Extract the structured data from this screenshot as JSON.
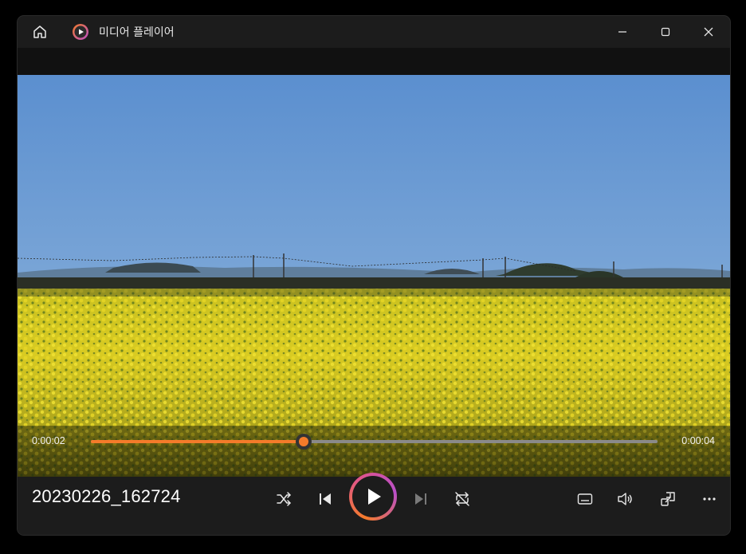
{
  "window": {
    "title": "미디어 플레이어",
    "controls": [
      "minimize-icon",
      "maximize-icon",
      "close-icon"
    ]
  },
  "titlebar_icons": {
    "home": "home-icon",
    "app": "media-player-app-icon"
  },
  "playback": {
    "current_time": "0:00:02",
    "duration": "0:00:04",
    "progress_fraction": 0.375
  },
  "media": {
    "filename": "20230226_162724"
  },
  "transport": {
    "shuffle": "shuffle-icon",
    "previous": "previous-icon",
    "play": "play-icon",
    "next": "next-icon",
    "repeat": "repeat-icon"
  },
  "right_controls": {
    "captions": "captions-icon",
    "volume": "volume-icon",
    "miniplayer": "miniplayer-icon",
    "more": "more-icon"
  },
  "colors": {
    "accent": "#f47b2a",
    "window_bg": "#1c1c1c",
    "sky": "#5e8fca",
    "flowers": "#d6c61e"
  }
}
